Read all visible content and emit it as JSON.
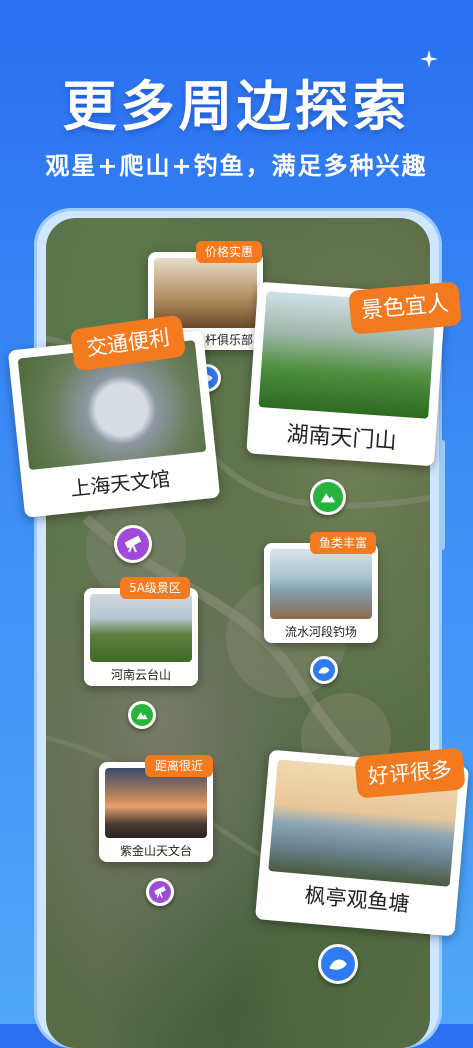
{
  "header": {
    "title": "更多周边探索",
    "subtitle": "观星+爬山+钓鱼，满足多种兴趣"
  },
  "colors": {
    "tag_orange": "#f47a1f",
    "pin_blue": "#2f7cf0",
    "pin_green": "#27b43c",
    "pin_purple": "#a04bd8"
  },
  "spots": {
    "club": {
      "tag": "价格实惠",
      "name": "杆俱乐部",
      "icon": "fish-pin-icon"
    },
    "tianmen": {
      "tag": "景色宜人",
      "name": "湖南天门山",
      "icon": "mountain-pin-icon"
    },
    "planetarium": {
      "tag": "交通便利",
      "name": "上海天文馆",
      "icon": "telescope-pin-icon"
    },
    "fishing": {
      "tag": "鱼类丰富",
      "name": "流水河段钓场",
      "icon": "fish-pin-icon"
    },
    "yuntai": {
      "tag": "5A级景区",
      "name": "河南云台山",
      "icon": "mountain-pin-icon"
    },
    "zijin": {
      "tag": "距离很近",
      "name": "紫金山天文台",
      "icon": "telescope-pin-icon"
    },
    "fengting": {
      "tag": "好评很多",
      "name": "枫亭观鱼塘",
      "icon": "fish-pin-icon"
    }
  }
}
